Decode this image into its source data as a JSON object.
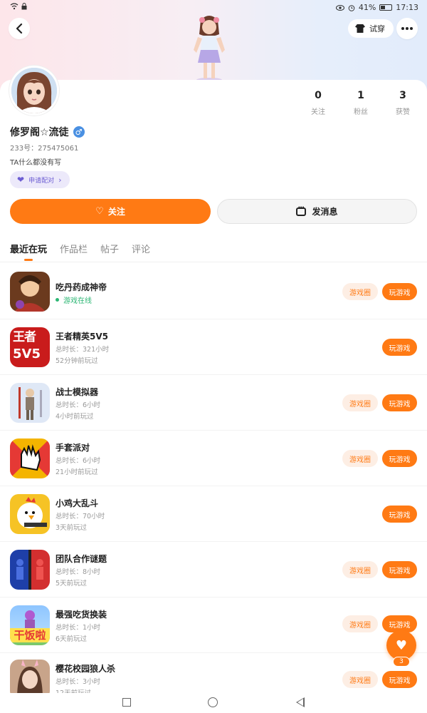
{
  "status_bar": {
    "battery": "41%",
    "time": "17:13"
  },
  "header": {
    "back_icon": "back-arrow-icon",
    "tryon_label": "试穿",
    "more_icon": "more-dots-icon"
  },
  "profile": {
    "name": "修罗阁☆流徒",
    "gender_symbol": "♂",
    "uid": "233号：275475061",
    "bio": "TA什么都没有写",
    "pair_label": "申请配对",
    "stats": [
      {
        "value": "0",
        "label": "关注"
      },
      {
        "value": "1",
        "label": "粉丝"
      },
      {
        "value": "3",
        "label": "获赞"
      }
    ]
  },
  "actions": {
    "follow_label": "关注",
    "message_label": "发消息"
  },
  "tabs": [
    "最近在玩",
    "作品栏",
    "帖子",
    "评论"
  ],
  "games": [
    {
      "title": "吃丹药成神帝",
      "status": "游戏在线",
      "duration": "",
      "last": "",
      "circle": "游戏圈",
      "play": "玩游戏"
    },
    {
      "title": "王者精英5V5",
      "status": "",
      "duration": "总时长：321小时",
      "last": "52分钟前玩过",
      "circle": "",
      "play": "玩游戏"
    },
    {
      "title": "战士模拟器",
      "status": "",
      "duration": "总时长：6小时",
      "last": "4小时前玩过",
      "circle": "游戏圈",
      "play": "玩游戏"
    },
    {
      "title": "手套派对",
      "status": "",
      "duration": "总时长：6小时",
      "last": "21小时前玩过",
      "circle": "游戏圈",
      "play": "玩游戏"
    },
    {
      "title": "小鸡大乱斗",
      "status": "",
      "duration": "总时长：70小时",
      "last": "3天前玩过",
      "circle": "",
      "play": "玩游戏"
    },
    {
      "title": "团队合作谜题",
      "status": "",
      "duration": "总时长：8小时",
      "last": "5天前玩过",
      "circle": "游戏圈",
      "play": "玩游戏"
    },
    {
      "title": "最强吃货换装",
      "status": "",
      "duration": "总时长：1小时",
      "last": "6天前玩过",
      "circle": "游戏圈",
      "play": "玩游戏"
    },
    {
      "title": "樱花校园狼人杀",
      "status": "",
      "duration": "总时长：3小时",
      "last": "12天前玩过",
      "circle": "游戏圈",
      "play": "玩游戏"
    }
  ],
  "icon_text": {
    "king_top": "王者",
    "king_bottom": "5V5",
    "food_text": "干饭啦"
  },
  "fab": {
    "count": "3"
  },
  "colors": {
    "accent": "#ff7a14",
    "online": "#2bb673",
    "pair": "#6c5dd3"
  }
}
